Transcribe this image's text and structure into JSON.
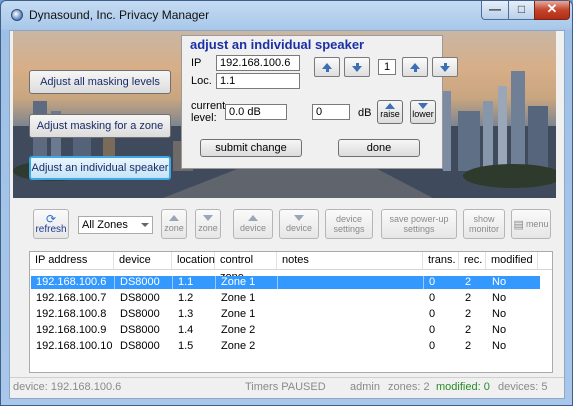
{
  "window": {
    "title": "Dynasound, Inc.  Privacy Manager"
  },
  "banner_buttons": {
    "adjust_all": "Adjust all masking levels",
    "adjust_zone": "Adjust masking for a zone",
    "adjust_individual": "Adjust an individual speaker"
  },
  "panel": {
    "title": "adjust an individual speaker",
    "ip_label": "IP",
    "ip_value": "192.168.100.6",
    "loc_label": "Loc.",
    "loc_value": "1.1",
    "index_value": "1",
    "current_level_label_1": "current",
    "current_level_label_2": "level:",
    "current_level_value": "0.0 dB",
    "adjust_value": "0",
    "db_label": "dB",
    "raise_label": "raise",
    "lower_label": "lower",
    "submit_label": "submit change",
    "done_label": "done"
  },
  "toolbar": {
    "refresh": "refresh",
    "zone_select": "All Zones",
    "zone_up": "zone",
    "zone_down": "zone",
    "device_up": "device",
    "device_down": "device",
    "device_settings_1": "device",
    "device_settings_2": "settings",
    "save_powerup_1": "save power-up",
    "save_powerup_2": "settings",
    "show_monitor_1": "show",
    "show_monitor_2": "monitor",
    "menu": "menu"
  },
  "table": {
    "columns": [
      "IP address",
      "device",
      "location",
      "control zone",
      "notes",
      "trans.",
      "rec.",
      "modified"
    ],
    "rows": [
      [
        "192.168.100.6",
        "DS8000",
        "1.1",
        "Zone 1",
        "",
        "0",
        "2",
        "No"
      ],
      [
        "192.168.100.7",
        "DS8000",
        "1.2",
        "Zone 1",
        "",
        "0",
        "2",
        "No"
      ],
      [
        "192.168.100.8",
        "DS8000",
        "1.3",
        "Zone 1",
        "",
        "0",
        "2",
        "No"
      ],
      [
        "192.168.100.9",
        "DS8000",
        "1.4",
        "Zone 2",
        "",
        "0",
        "2",
        "No"
      ],
      [
        "192.168.100.10",
        "DS8000",
        "1.5",
        "Zone 2",
        "",
        "0",
        "2",
        "No"
      ]
    ],
    "selected_row": 0
  },
  "status": {
    "device": "device: 192.168.100.6",
    "timers": "Timers PAUSED",
    "user": "admin",
    "zones": "zones: 2",
    "modified": "modified: 0",
    "devices": "devices: 5"
  },
  "colors": {
    "selection": "#3399ff",
    "panel_title": "#1b2fa8",
    "modified_status": "#2a8a2a"
  }
}
